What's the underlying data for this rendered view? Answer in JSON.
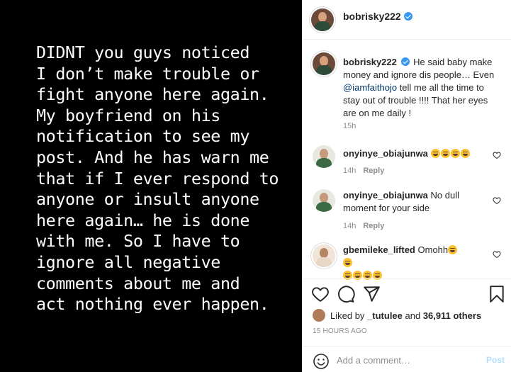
{
  "post_image": {
    "text": "DIDNT you guys noticed\nI don’t make trouble or\nfight anyone here again.\nMy boyfriend on his\nnotification to see my\npost. And he has warn me\nthat if I ever respond to\nanyone or insult anyone\nhere again… he is done\nwith me. So I have to\nignore all negative\ncomments about me and\nact nothing ever happen."
  },
  "header": {
    "username": "bobrisky222",
    "verified": true
  },
  "caption": {
    "username": "bobrisky222",
    "text_before": "He said baby make money and ignore dis people… Even ",
    "mention": "@iamfaithojo",
    "text_after": " tell me all the time to stay out of trouble !!!! That her eyes are on me daily !",
    "time": "15h"
  },
  "comments": [
    {
      "username": "onyinye_obiajunwa",
      "text": "",
      "emojis": 4,
      "time": "14h",
      "reply_label": "Reply"
    },
    {
      "username": "onyinye_obiajunwa",
      "text": "No dull moment for your side",
      "emojis": 0,
      "time": "14h",
      "reply_label": "Reply"
    },
    {
      "username": "gbemileke_lifted",
      "text": "Omohh",
      "emojis": 6,
      "time": "",
      "reply_label": ""
    }
  ],
  "likes": {
    "prefix": "Liked by ",
    "user": "_tutulee",
    "middle": " and ",
    "count": "36,911 others"
  },
  "post_time": "15 HOURS AGO",
  "add_comment": {
    "placeholder": "Add a comment…",
    "post_label": "Post"
  },
  "icons": {
    "verified": "verified-badge-icon",
    "like": "heart-icon",
    "comment": "comment-icon",
    "share": "share-icon",
    "save": "bookmark-icon",
    "emoji": "smiley-icon"
  },
  "colors": {
    "verified": "#3897f0",
    "mention": "#00376b",
    "post_disabled": "#b2dffc",
    "muted": "#8e8e8e"
  }
}
